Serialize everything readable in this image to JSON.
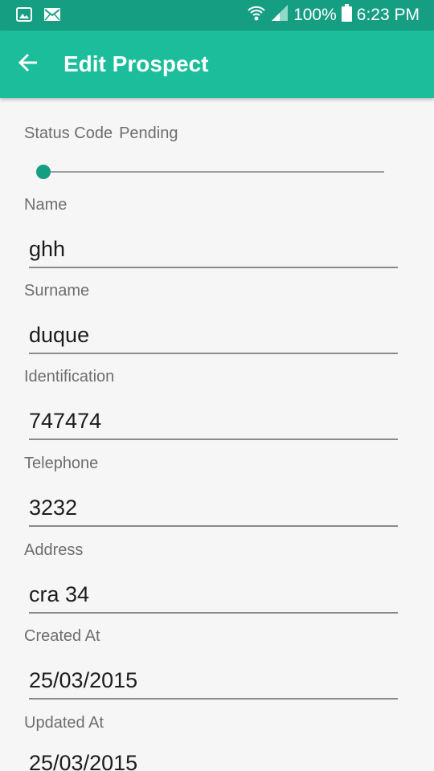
{
  "status_bar": {
    "notification_icons": [
      "image-icon",
      "email-icon"
    ],
    "battery_text": "100%",
    "time": "6:23 PM"
  },
  "app_bar": {
    "title": "Edit Prospect",
    "back_icon": "arrow-back-icon"
  },
  "form": {
    "status_code_label": "Status Code",
    "status_code_value": "Pending",
    "status_slider_level": 0,
    "fields": [
      {
        "label": "Name",
        "value": "ghh"
      },
      {
        "label": "Surname",
        "value": "duque"
      },
      {
        "label": "Identification",
        "value": "747474"
      },
      {
        "label": "Telephone",
        "value": "3232"
      },
      {
        "label": "Address",
        "value": "cra 34"
      },
      {
        "label": "Created At",
        "value": "25/03/2015"
      },
      {
        "label": "Updated At",
        "value": "25/03/2015"
      }
    ]
  },
  "colors": {
    "status_bar": "#169e83",
    "app_bar": "#1bbd9a",
    "accent": "#169e83",
    "background": "#f6f6f6"
  }
}
